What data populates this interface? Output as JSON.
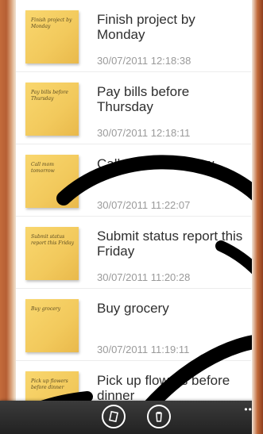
{
  "notes": [
    {
      "thumb_text": "Finish project by Monday",
      "title": "Finish project by Monday",
      "date": "30/07/2011 12:18:38"
    },
    {
      "thumb_text": "Pay bills before Thursday",
      "title": "Pay bills before Thursday",
      "date": "30/07/2011 12:18:11"
    },
    {
      "thumb_text": "Call mom tomorrow",
      "title": "Call mom tomorrow",
      "date": "30/07/2011 11:22:07"
    },
    {
      "thumb_text": "Submit status report this Friday",
      "title": "Submit status report this Friday",
      "date": "30/07/2011 11:20:28"
    },
    {
      "thumb_text": "Buy grocery",
      "title": "Buy grocery",
      "date": "30/07/2011 11:19:11"
    },
    {
      "thumb_text": "Pick up flowers before dinner",
      "title": "Pick up flowers before dinner",
      "date": ""
    }
  ],
  "app_bar": {
    "icons": [
      "note-icon",
      "delete-icon"
    ],
    "more": "•••"
  },
  "watermark": {
    "color": "#000000"
  }
}
